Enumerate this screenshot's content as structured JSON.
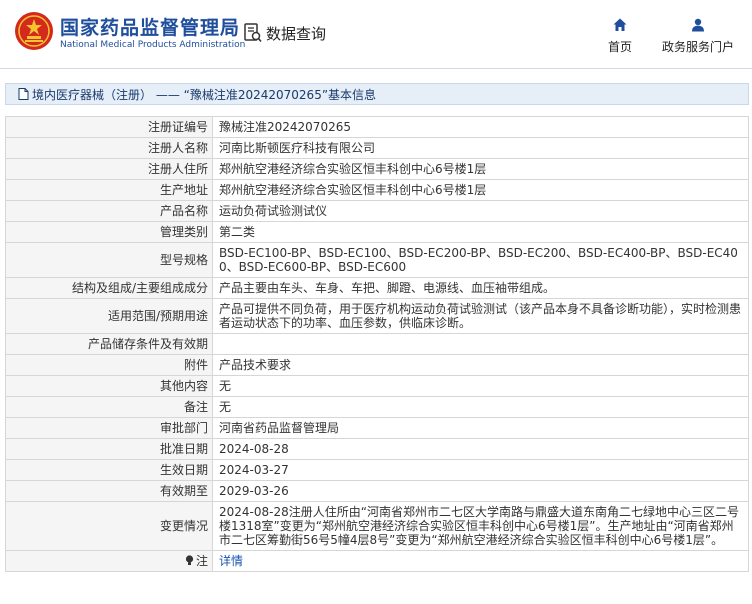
{
  "header": {
    "logo_cn": "国家药品监督管理局",
    "logo_en": "National Medical Products Administration",
    "query_label": "数据查询",
    "nav_home": "首页",
    "nav_portal": "政务服务门户"
  },
  "breadcrumb": {
    "text": "境内医疗器械（注册） —— “豫械注准20242070265”基本信息"
  },
  "rows": [
    {
      "k": "注册证编号",
      "v": "豫械注准20242070265"
    },
    {
      "k": "注册人名称",
      "v": "河南比斯顿医疗科技有限公司"
    },
    {
      "k": "注册人住所",
      "v": "郑州航空港经济综合实验区恒丰科创中心6号楼1层"
    },
    {
      "k": "生产地址",
      "v": "郑州航空港经济综合实验区恒丰科创中心6号楼1层"
    },
    {
      "k": "产品名称",
      "v": "运动负荷试验测试仪"
    },
    {
      "k": "管理类别",
      "v": "第二类"
    },
    {
      "k": "型号规格",
      "v": "BSD-EC100-BP、BSD-EC100、BSD-EC200-BP、BSD-EC200、BSD-EC400-BP、BSD-EC400、BSD-EC600-BP、BSD-EC600"
    },
    {
      "k": "结构及组成/主要组成成分",
      "v": "产品主要由车头、车身、车把、脚蹬、电源线、血压袖带组成。"
    },
    {
      "k": "适用范围/预期用途",
      "v": "产品可提供不同负荷，用于医疗机构运动负荷试验测试（该产品本身不具备诊断功能），实时检测患者运动状态下的功率、血压参数，供临床诊断。"
    },
    {
      "k": "产品储存条件及有效期",
      "v": ""
    },
    {
      "k": "附件",
      "v": "产品技术要求"
    },
    {
      "k": "其他内容",
      "v": "无"
    },
    {
      "k": "备注",
      "v": "无"
    },
    {
      "k": "审批部门",
      "v": "河南省药品监督管理局"
    },
    {
      "k": "批准日期",
      "v": "2024-08-28"
    },
    {
      "k": "生效日期",
      "v": "2024-03-27"
    },
    {
      "k": "有效期至",
      "v": "2029-03-26"
    },
    {
      "k": "变更情况",
      "v": "2024-08-28注册人住所由“河南省郑州市二七区大学南路与鼎盛大道东南角二七绿地中心三区二号楼1318室”变更为“郑州航空港经济综合实验区恒丰科创中心6号楼1层”。生产地址由“河南省郑州市二七区筹勤街56号5幢4层8号”变更为“郑州航空港经济综合实验区恒丰科创中心6号楼1层”。"
    }
  ],
  "note": {
    "label": "注",
    "link": "详情"
  },
  "colors": {
    "brand_blue": "#1f4e9c",
    "emblem_red": "#d42a1e",
    "link_blue": "#1a55b0",
    "crumb_bg": "#e6eef8",
    "label_bg": "#f5f5f5"
  },
  "icons": {
    "logo": "national-emblem-icon",
    "query": "data-query-icon",
    "home": "home-icon",
    "portal": "user-icon",
    "breadcrumb": "document-icon",
    "note": "lightbulb-icon"
  }
}
